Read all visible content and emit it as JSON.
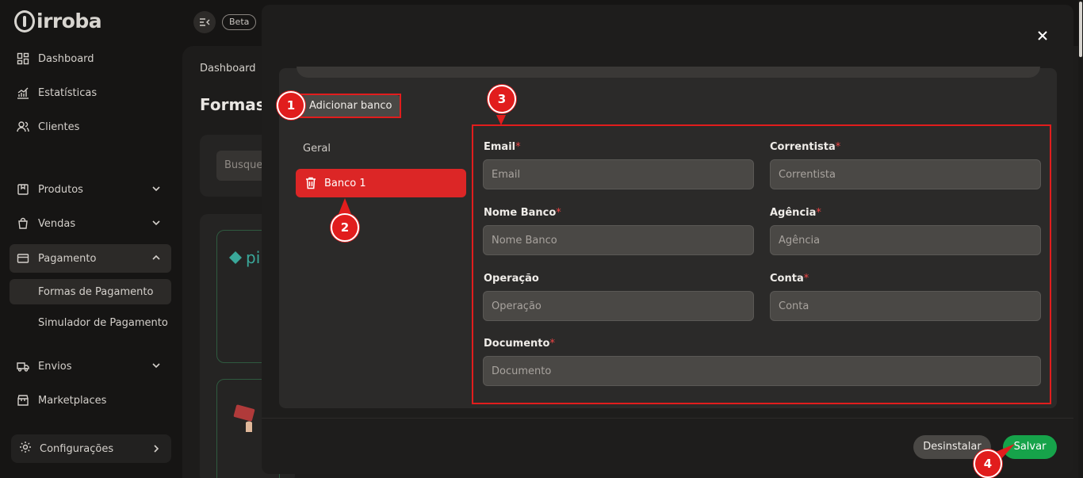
{
  "sidebar": {
    "logo_text": "irroba",
    "items": [
      {
        "label": "Dashboard"
      },
      {
        "label": "Estatísticas"
      },
      {
        "label": "Clientes"
      },
      {
        "label": "Produtos"
      },
      {
        "label": "Vendas"
      },
      {
        "label": "Pagamento"
      },
      {
        "label": "Envios"
      },
      {
        "label": "Marketplaces"
      }
    ],
    "sub_items": [
      {
        "label": "Formas de Pagamento"
      },
      {
        "label": "Simulador de Pagamento"
      }
    ],
    "config_label": "Configurações"
  },
  "topbar": {
    "beta_label": "Beta"
  },
  "background": {
    "breadcrumb": "Dashboard",
    "title": "Formas",
    "search_placeholder": "Busque",
    "pix_text": "pi"
  },
  "modal": {
    "add_bank_label": "Adicionar banco",
    "tabs": [
      {
        "label": "Geral"
      },
      {
        "label": "Banco 1"
      }
    ],
    "fields": {
      "email": {
        "label": "Email",
        "required": "*",
        "placeholder": "Email"
      },
      "correntista": {
        "label": "Correntista",
        "required": "*",
        "placeholder": "Correntista"
      },
      "nome_banco": {
        "label": "Nome Banco",
        "required": "*",
        "placeholder": "Nome Banco"
      },
      "agencia": {
        "label": "Agência",
        "required": "*",
        "placeholder": "Agência"
      },
      "operacao": {
        "label": "Operação",
        "placeholder": "Operação"
      },
      "conta": {
        "label": "Conta",
        "required": "*",
        "placeholder": "Conta"
      },
      "documento": {
        "label": "Documento",
        "required": "*",
        "placeholder": "Documento"
      }
    },
    "uninstall_label": "Desinstalar",
    "save_label": "Salvar"
  },
  "annotations": [
    {
      "number": "1"
    },
    {
      "number": "2"
    },
    {
      "number": "3"
    },
    {
      "number": "4"
    }
  ],
  "colors": {
    "accent_red": "#dc2626",
    "save_green": "#16a34a",
    "annotation_red": "#e11d1d"
  }
}
